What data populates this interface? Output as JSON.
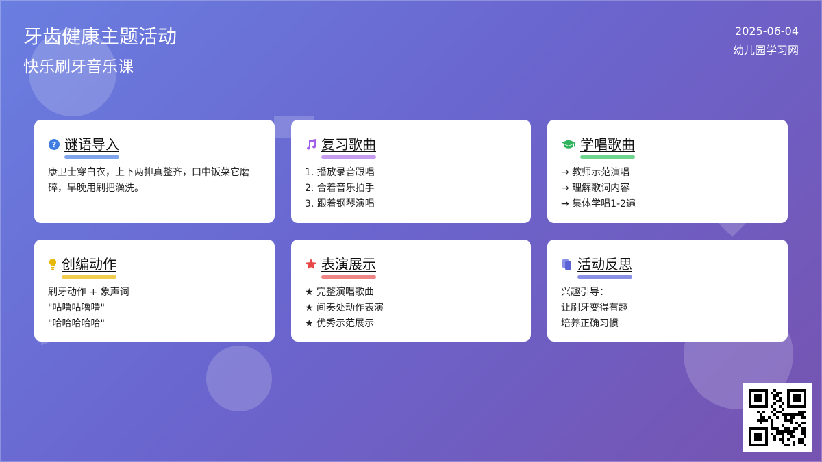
{
  "header": {
    "title": "牙齿健康主题活动",
    "subtitle": "快乐刷牙音乐课",
    "date": "2025-06-04",
    "site": "幼儿园学习网"
  },
  "cards": [
    {
      "title": "谜语导入",
      "icon": "question-circle-icon",
      "accent": "#7fa6ec",
      "icon_color": "#3f7de0",
      "text": "康卫士穿白衣，上下两排真整齐，口中饭菜它磨碎，早晚用刷把澡洗。"
    },
    {
      "title": "复习歌曲",
      "icon": "music-note-icon",
      "accent": "#c79bef",
      "icon_color": "#a35ee6",
      "lines": [
        "1. 播放录音跟唱",
        "2. 合着音乐拍手",
        "3. 跟着钢琴演唱"
      ]
    },
    {
      "title": "学唱歌曲",
      "icon": "graduation-cap-icon",
      "accent": "#6dd58f",
      "icon_color": "#2fb35c",
      "lines": [
        "→ 教师示范演唱",
        "→ 理解歌词内容",
        "→ 集体学唱1-2遍"
      ]
    },
    {
      "title": "创编动作",
      "icon": "lightbulb-icon",
      "accent": "#f1cc4d",
      "icon_color": "#e8b90d",
      "lines": [
        "刷牙动作",
        " + 象声词",
        "\"咕噜咕噜噜\"",
        "\"哈哈哈哈哈\""
      ]
    },
    {
      "title": "表演展示",
      "icon": "star-icon",
      "accent": "#f08585",
      "icon_color": "#e84747",
      "lines": [
        "★ 完整演唱歌曲",
        "★ 间奏处动作表演",
        "★ 优秀示范展示"
      ]
    },
    {
      "title": "活动反思",
      "icon": "clipboard-icon",
      "accent": "#8a8fe6",
      "icon_color": "#5b62d6",
      "lines": [
        "兴趣引导：",
        "让刷牙变得有趣",
        "培养正确习惯"
      ]
    }
  ]
}
